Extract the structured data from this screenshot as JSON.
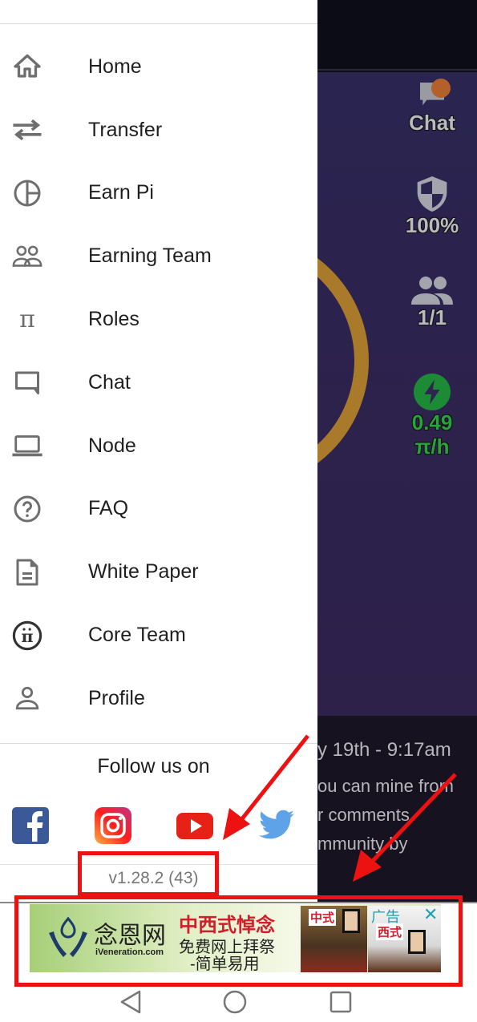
{
  "background_app": {
    "stats": {
      "chat_label": "Chat",
      "security": "100%",
      "team": "1/1",
      "rate_value": "0.49",
      "rate_unit": "π/h"
    },
    "news_lines": [
      "y 19th - 9:17am",
      "ou can mine from",
      "r comments",
      "mmunity by"
    ],
    "colors": {
      "ring": "#a97a2a",
      "rate": "#27a33e",
      "badge": "#b4602a"
    }
  },
  "drawer": {
    "menu": [
      {
        "label": "Home",
        "icon": "home-icon"
      },
      {
        "label": "Transfer",
        "icon": "transfer-icon"
      },
      {
        "label": "Earn Pi",
        "icon": "pie-chart-icon"
      },
      {
        "label": "Earning Team",
        "icon": "team-icon"
      },
      {
        "label": "Roles",
        "icon": "pi-icon"
      },
      {
        "label": "Chat",
        "icon": "chat-icon"
      },
      {
        "label": "Node",
        "icon": "laptop-icon"
      },
      {
        "label": "FAQ",
        "icon": "help-icon"
      },
      {
        "label": "White Paper",
        "icon": "document-icon"
      },
      {
        "label": "Core Team",
        "icon": "pi-circle-icon"
      },
      {
        "label": "Profile",
        "icon": "person-icon"
      }
    ],
    "follow_label": "Follow us on",
    "social": [
      "facebook",
      "instagram",
      "youtube",
      "twitter"
    ],
    "version": "v1.28.2 (43)"
  },
  "ad": {
    "logo_cn": "念恩网",
    "logo_en": "iVeneration.com",
    "title": "中西式悼念",
    "subtitle1": "免费网上拜祭",
    "subtitle2": "-简单易用",
    "image_tag1": "中式",
    "image_tag2": "西式",
    "ad_label": "广告",
    "close": "✕"
  }
}
